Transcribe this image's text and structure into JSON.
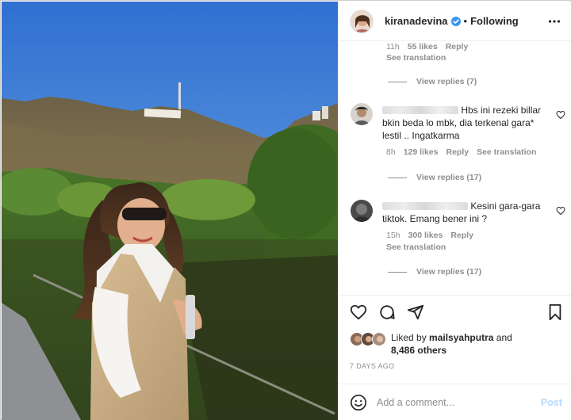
{
  "post": {
    "username": "kiranadevina",
    "follow_separator": "•",
    "follow_label": "Following",
    "more_icon": "more-horizontal-icon"
  },
  "comments": {
    "top_partial": {
      "time": "11h",
      "likes": "55 likes",
      "reply": "Reply",
      "see_translation": "See translation",
      "view_replies": "View replies (7)"
    },
    "items": [
      {
        "text_line1": "Hbs ini rezeki billar",
        "text_line2": "bkin beda lo mbk, dia terkenal gara*",
        "text_line3": "lestil .. Ingatkarma",
        "time": "8h",
        "likes": "129 likes",
        "reply": "Reply",
        "see_translation": "See translation",
        "view_replies": "View replies (17)"
      },
      {
        "text_line1": "Kesini gara-gara",
        "text_line2": "tiktok. Emang bener ini ?",
        "time": "15h",
        "likes": "300 likes",
        "reply": "Reply",
        "see_translation": "See translation",
        "view_replies": "View replies (17)"
      }
    ]
  },
  "likes": {
    "prefix": "Liked by",
    "liker": "mailsyahputra",
    "conj": "and",
    "others": "8,486 others"
  },
  "date": "7 DAYS AGO",
  "add_comment": {
    "placeholder": "Add a comment...",
    "post_label": "Post"
  },
  "colors": {
    "verified": "#3897f0",
    "muted": "#8e8e8e",
    "post_disabled": "#b3dbff"
  }
}
